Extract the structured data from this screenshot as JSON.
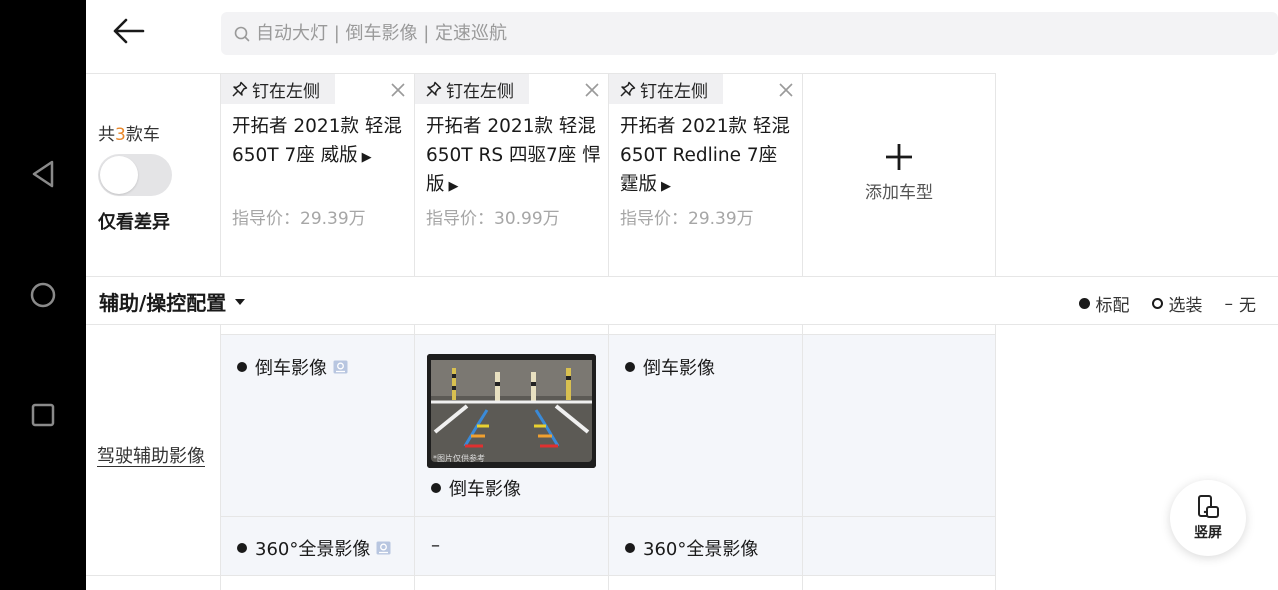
{
  "search": {
    "placeholder": "自动大灯 | 倒车影像 | 定速巡航"
  },
  "compare": {
    "count_prefix": "共",
    "count": "3",
    "count_suffix": "款车",
    "diff_only_label": "仅看差异",
    "diff_only_on": false
  },
  "cars": [
    {
      "pin_label": "钉在左侧",
      "name": "开拓者 2021款 轻混 650T 7座 威版",
      "price": "指导价：29.39万"
    },
    {
      "pin_label": "钉在左侧",
      "name": "开拓者 2021款 轻混 650T RS 四驱7座 悍版",
      "price": "指导价：30.99万"
    },
    {
      "pin_label": "钉在左侧",
      "name": "开拓者 2021款 轻混 650T Redline 7座 霆版",
      "price": "指导价：29.39万"
    }
  ],
  "add_car": {
    "label": "添加车型"
  },
  "section": {
    "title": "辅助/操控配置",
    "legend": {
      "standard": "标配",
      "optional": "选装",
      "none": "无"
    }
  },
  "rows": {
    "driving_assist": {
      "label": "驾驶辅助影像",
      "reverse": {
        "car1": "倒车影像",
        "car2": "倒车影像",
        "car3": "倒车影像"
      },
      "panoramic": {
        "car1": "360°全景影像",
        "car2": "–",
        "car3": "360°全景影像"
      }
    }
  },
  "thumbnail": {
    "caption": "*图片仅供参考"
  },
  "portrait_button": {
    "label": "竖屏"
  },
  "colors": {
    "accent_orange": "#e8872a",
    "cell_bg": "#f4f6fa",
    "grid": "#e6e6e6"
  }
}
